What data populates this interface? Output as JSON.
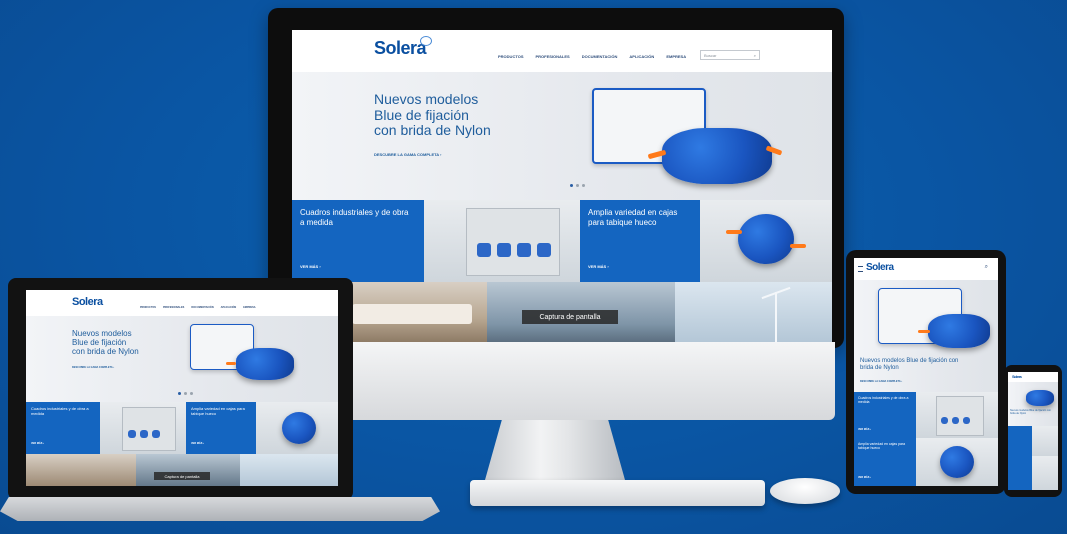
{
  "brand": {
    "name": "Solera"
  },
  "nav": {
    "items": [
      "Productos",
      "Profesionales",
      "Documentación",
      "Aplicación",
      "Empresa"
    ],
    "search_placeholder": "Buscar"
  },
  "hero": {
    "title_line1": "Nuevos modelos",
    "title_line2": "Blue de fijación",
    "title_line3": "con brida de Nylon",
    "title_tablet": "Nuevos modelos Blue de fijación con brida de Nylon",
    "link": "Descubre la gama completa",
    "slides": 3,
    "active_slide": 1
  },
  "panels": {
    "left_text": "Cuadros industriales y de obra a medida",
    "left_link": "Ver más",
    "right_text": "Amplia variedad en cajas para tabique hueco",
    "right_link": "Ver más"
  },
  "photo_caption": "Captura de pantalla",
  "colors": {
    "background": "#0a55a3",
    "brand_blue": "#1465c0",
    "accent_orange": "#ff7a1a"
  }
}
